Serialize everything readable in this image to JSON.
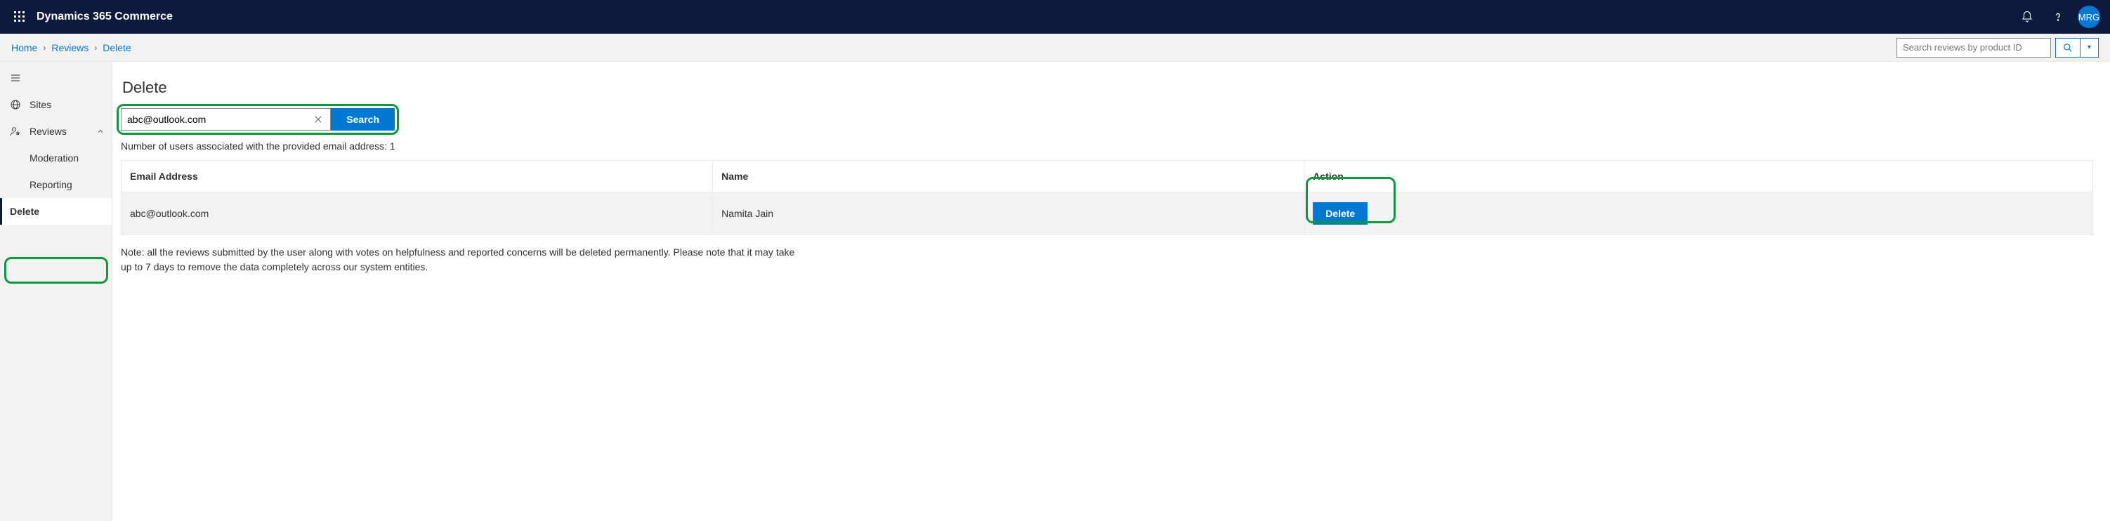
{
  "header": {
    "app_title": "Dynamics 365 Commerce",
    "avatar_initials": "MRG"
  },
  "breadcrumb": {
    "items": [
      "Home",
      "Reviews",
      "Delete"
    ]
  },
  "global_search": {
    "placeholder": "Search reviews by product ID"
  },
  "sidebar": {
    "items": [
      {
        "label": "Sites"
      },
      {
        "label": "Reviews",
        "expanded": true,
        "children": [
          {
            "label": "Moderation"
          },
          {
            "label": "Reporting"
          },
          {
            "label": "Delete",
            "active": true
          }
        ]
      }
    ]
  },
  "page": {
    "title": "Delete",
    "email_search": {
      "value": "abc@outlook.com",
      "search_label": "Search"
    },
    "result_count_prefix": "Number of users associated with the provided email address: ",
    "result_count": "1",
    "table": {
      "headers": {
        "email": "Email Address",
        "name": "Name",
        "action": "Action"
      },
      "rows": [
        {
          "email": "abc@outlook.com",
          "name": "Namita Jain",
          "action_label": "Delete"
        }
      ]
    },
    "note": "Note: all the reviews submitted by the user along with votes on helpfulness and reported concerns will be deleted permanently. Please note that it may take up to 7 days to remove the data completely across our system entities."
  }
}
